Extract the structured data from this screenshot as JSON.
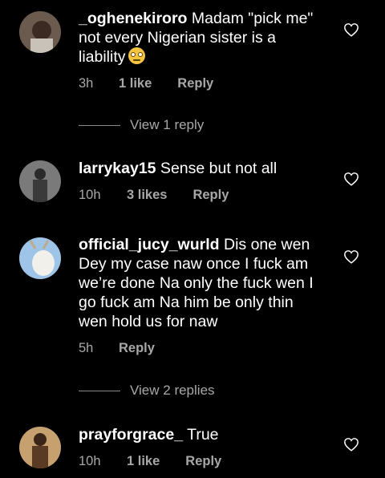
{
  "comments": [
    {
      "username": "_oghenekiroro",
      "text": " Madam \"pick me\" not every Nigerian sister is a liability",
      "emoji": "face-with-rolling-eyes",
      "time": "3h",
      "likes": "1 like",
      "reply": "Reply"
    },
    {
      "username": "larrykay15",
      "text": " Sense but not all",
      "time": "10h",
      "likes": "3 likes",
      "reply": "Reply"
    },
    {
      "username": "official_jucy_wurld",
      "text": " Dis one wen Dey my case naw once I fuck am we’re done Na only the fuck wen I go fuck am Na him be only thin wen hold us for naw",
      "time": "5h",
      "likes": "",
      "reply": "Reply"
    },
    {
      "username": "prayforgrace_",
      "text": " True",
      "time": "10h",
      "likes": "1 like",
      "reply": "Reply"
    }
  ],
  "view_replies": [
    "View 1 reply",
    "View 2 replies"
  ],
  "icons": {
    "like": "heart-outline-icon"
  },
  "colors": {
    "background": "#000000",
    "text": "#ffffff",
    "secondary": "#a8a8a8"
  }
}
